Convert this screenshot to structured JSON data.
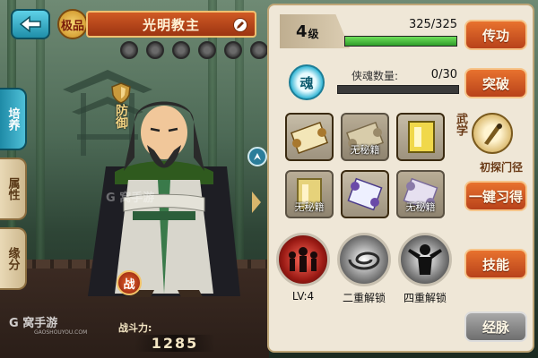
{
  "header": {
    "grade_badge": "极品",
    "hero_name": "光明教主",
    "role": "防御"
  },
  "side_tabs": [
    {
      "label": "培养",
      "active": true
    },
    {
      "label": "属性",
      "active": false
    },
    {
      "label": "缘分",
      "active": false
    }
  ],
  "hero": {
    "fight_label": "战",
    "power_label": "战斗力:",
    "power_value": "1285"
  },
  "watermark": {
    "brand": "G 窝手游",
    "brand_sub": "GAOSHOUYOU.COM",
    "brand_mid": "G 窝手游"
  },
  "panel": {
    "level": "4",
    "level_unit": "级",
    "exp": "325/325",
    "exp_progress": 1.0,
    "soul_icon_label": "魂",
    "soul_label": "侠魂数量:",
    "soul_value": "0/30",
    "soul_progress": 0.0,
    "scrolls": [
      {
        "label": "",
        "state": "equipped"
      },
      {
        "label": "无秘籍",
        "state": "empty"
      },
      {
        "label": "",
        "state": "equipped"
      },
      {
        "label": "无秘籍",
        "state": "empty"
      },
      {
        "label": "",
        "state": "equipped"
      },
      {
        "label": "无秘籍",
        "state": "empty"
      }
    ],
    "martial_tag": "武学",
    "martial_rank": "初探门径",
    "orbs": [
      {
        "label": "LV:4"
      },
      {
        "label": "二重解锁"
      },
      {
        "label": "四重解锁"
      }
    ],
    "buttons": {
      "pass_on": "传功",
      "break_through": "突破",
      "learn_all": "一键习得",
      "skills": "技能",
      "meridians": "经脉"
    }
  },
  "colors": {
    "accent_orange": "#d05a24",
    "exp_green": "#3fbf33",
    "panel_bg": "#efe7d7",
    "tab_active": "#1e8aa6"
  }
}
